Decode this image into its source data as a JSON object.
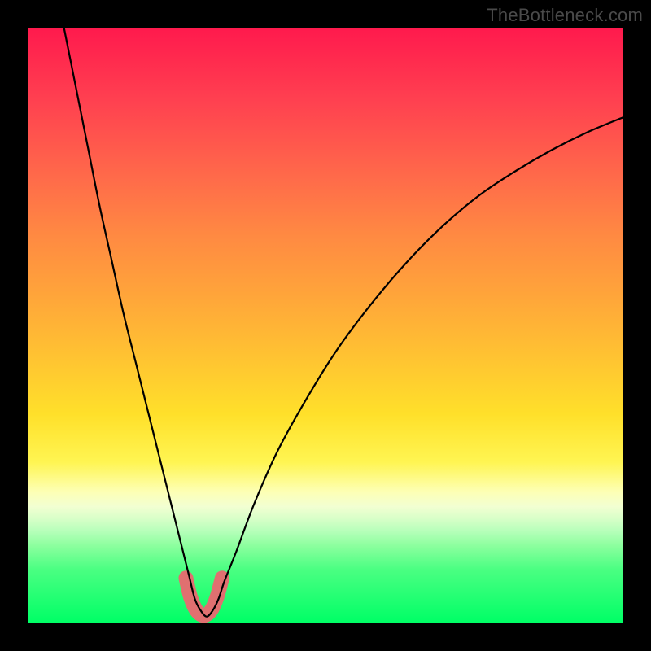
{
  "watermark": "TheBottleneck.com",
  "chart_data": {
    "type": "line",
    "title": "",
    "xlabel": "",
    "ylabel": "",
    "xlim": [
      0,
      100
    ],
    "ylim": [
      0,
      100
    ],
    "grid": false,
    "legend": false,
    "background_gradient": {
      "top_color": "#ff1a4d",
      "bottom_color": "#00ff66",
      "description": "vertical red-to-green heat gradient"
    },
    "series": [
      {
        "name": "bottleneck-curve",
        "color": "#000000",
        "x": [
          6,
          8,
          10,
          12,
          14,
          16,
          18,
          20,
          22,
          24,
          26,
          27,
          28,
          29,
          30,
          31,
          32,
          33,
          35,
          38,
          42,
          47,
          52,
          58,
          64,
          70,
          76,
          82,
          88,
          94,
          100
        ],
        "y": [
          100,
          90,
          80,
          70,
          61,
          52,
          44,
          36,
          28,
          20,
          12,
          8,
          4,
          2,
          1,
          2,
          4,
          7,
          12,
          20,
          29,
          38,
          46,
          54,
          61,
          67,
          72,
          76,
          79.5,
          82.5,
          85
        ]
      }
    ],
    "markers": {
      "name": "highlight-dots",
      "color": "#e07070",
      "radius": 7,
      "x": [
        26.5,
        27.3,
        28.3,
        29.5,
        30.7,
        31.7,
        32.6
      ],
      "y": [
        7.5,
        4.2,
        2.0,
        1.2,
        2.0,
        4.2,
        7.5
      ]
    },
    "highlight_tube": {
      "name": "valley-highlight",
      "color": "#e07070",
      "width": 18,
      "x": [
        26.5,
        27.3,
        28.3,
        29.5,
        30.7,
        31.7,
        32.6
      ],
      "y": [
        7.5,
        4.2,
        2.0,
        1.2,
        2.0,
        4.2,
        7.5
      ]
    }
  }
}
